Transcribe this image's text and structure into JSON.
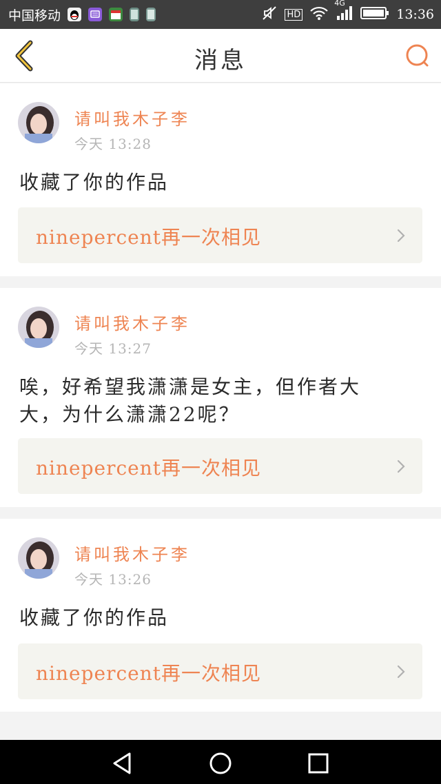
{
  "status_bar": {
    "carrier": "中国移动",
    "network": "4G",
    "hd": "HD",
    "time": "13:36",
    "icons": [
      "qq-icon",
      "chat-icon",
      "calendar-icon",
      "sim-icon",
      "doc-icon",
      "mute-icon",
      "wifi-icon",
      "signal-icon",
      "battery-icon"
    ]
  },
  "header": {
    "title": "消息",
    "back_icon": "back-chevron-icon",
    "search_icon": "search-icon"
  },
  "messages": [
    {
      "author": "请叫我木子李",
      "time": "今天 13:28",
      "content": "收藏了你的作品",
      "work_title": "ninepercent再一次相见"
    },
    {
      "author": "请叫我木子李",
      "time": "今天 13:27",
      "content": "唉，好希望我潇潇是女主，但作者大大，为什么潇潇22呢？",
      "work_title": "ninepercent再一次相见"
    },
    {
      "author": "请叫我木子李",
      "time": "今天 13:26",
      "content": "收藏了你的作品",
      "work_title": "ninepercent再一次相见"
    }
  ],
  "colors": {
    "accent": "#ee8452",
    "status_bar": "#3e3e3e",
    "link_bg": "#f4f4ef"
  },
  "system_nav": {
    "icons": [
      "back-triangle-icon",
      "home-circle-icon",
      "recents-square-icon"
    ]
  }
}
